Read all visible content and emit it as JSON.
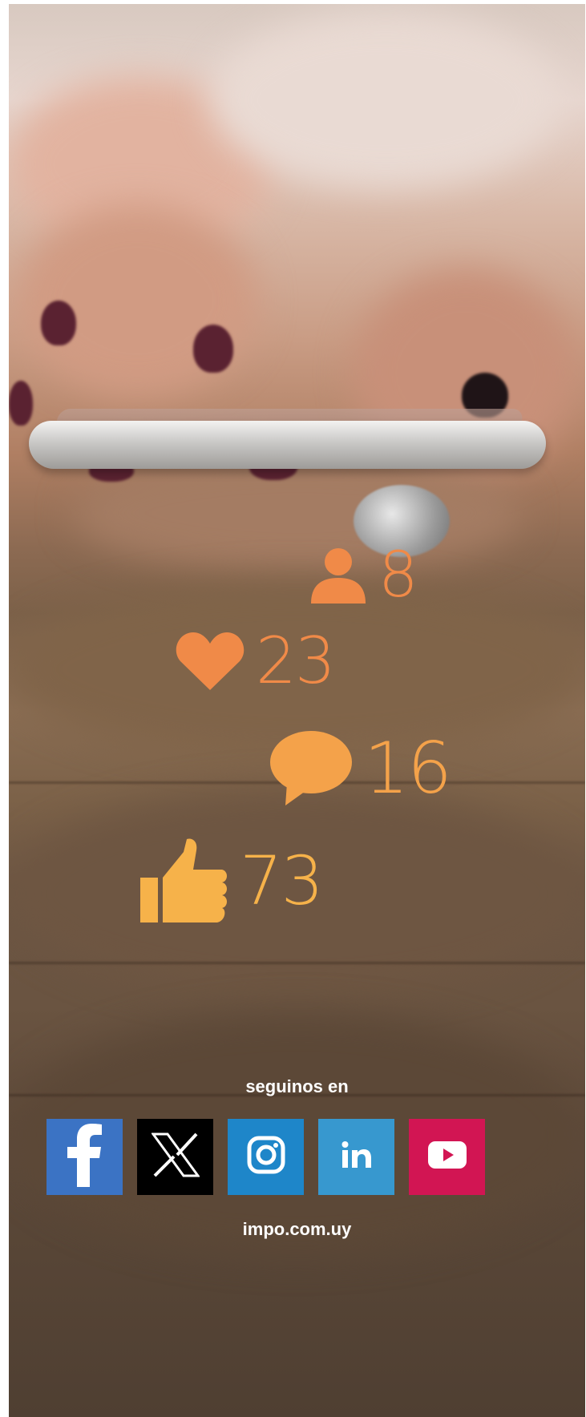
{
  "stats": [
    {
      "icon": "user-icon",
      "value": "8"
    },
    {
      "icon": "heart-icon",
      "value": "23"
    },
    {
      "icon": "comment-icon",
      "value": "16"
    },
    {
      "icon": "thumbs-up-icon",
      "value": "73"
    }
  ],
  "colors": {
    "stat_orange": "#f08a48",
    "stat_amber": "#f6b24a",
    "facebook": "#3b73c4",
    "x": "#000000",
    "instagram": "#1e86c9",
    "linkedin": "#3798cf",
    "youtube": "#d21553"
  },
  "footer": {
    "follow_label": "seguinos en",
    "site_url": "impo.com.uy"
  },
  "social": [
    {
      "name": "facebook-icon"
    },
    {
      "name": "x-icon"
    },
    {
      "name": "instagram-icon"
    },
    {
      "name": "linkedin-icon"
    },
    {
      "name": "youtube-icon"
    }
  ]
}
